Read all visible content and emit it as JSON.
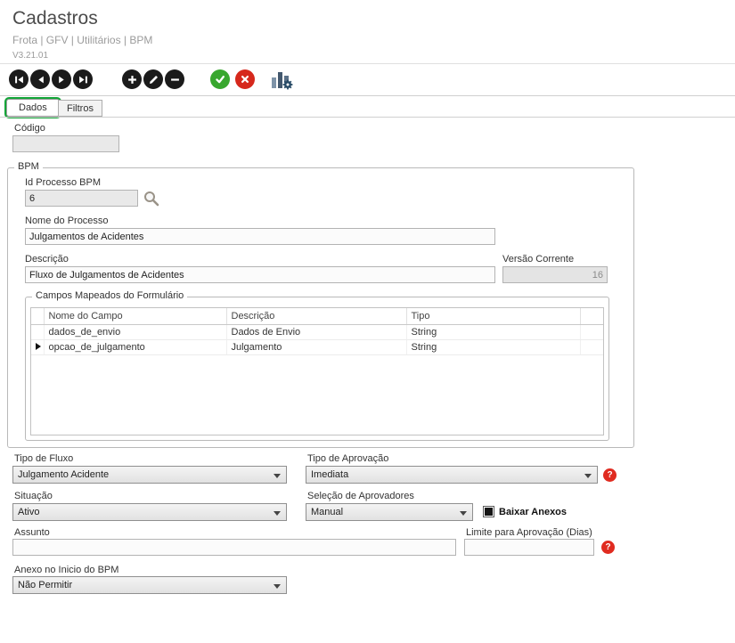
{
  "header": {
    "title": "Cadastros",
    "breadcrumb": "Frota | GFV | Utilitários | BPM",
    "version": "V3.21.01"
  },
  "toolbar": {
    "icons": [
      "first-record",
      "previous-record",
      "next-record",
      "last-record",
      "add-record",
      "edit-record",
      "delete-record",
      "confirm",
      "cancel",
      "bpm-chart-settings"
    ]
  },
  "tabs": {
    "dados": "Dados",
    "filtros": "Filtros"
  },
  "form": {
    "codigo": {
      "label": "Código",
      "value": ""
    },
    "bpm": {
      "title": "BPM",
      "id_processo": {
        "label": "Id Processo BPM",
        "value": "6"
      },
      "nome_processo": {
        "label": "Nome do Processo",
        "value": "Julgamentos de Acidentes"
      },
      "descricao": {
        "label": "Descrição",
        "value": "Fluxo de Julgamentos de Acidentes"
      },
      "versao_corrente": {
        "label": "Versão Corrente",
        "value": "16"
      },
      "campos": {
        "title": "Campos Mapeados do Formulário",
        "columns": [
          "Nome do Campo",
          "Descrição",
          "Tipo"
        ],
        "rows": [
          {
            "nome": "dados_de_envio",
            "descricao": "Dados de Envio",
            "tipo": "String"
          },
          {
            "nome": "opcao_de_julgamento",
            "descricao": "Julgamento",
            "tipo": "String"
          }
        ]
      }
    },
    "tipo_fluxo": {
      "label": "Tipo de Fluxo",
      "value": "Julgamento Acidente"
    },
    "tipo_aprovacao": {
      "label": "Tipo de Aprovação",
      "value": "Imediata"
    },
    "situacao": {
      "label": "Situação",
      "value": "Ativo"
    },
    "selecao_aprovadores": {
      "label": "Seleção de Aprovadores",
      "value": "Manual"
    },
    "baixar_anexos": {
      "label": "Baixar Anexos",
      "checked": true
    },
    "assunto": {
      "label": "Assunto",
      "value": ""
    },
    "limite_aprovacao": {
      "label": "Limite para Aprovação (Dias)",
      "value": ""
    },
    "anexo_inicio": {
      "label": "Anexo no Inicio do BPM",
      "value": "Não Permitir"
    }
  },
  "icons": {
    "help": "?"
  }
}
